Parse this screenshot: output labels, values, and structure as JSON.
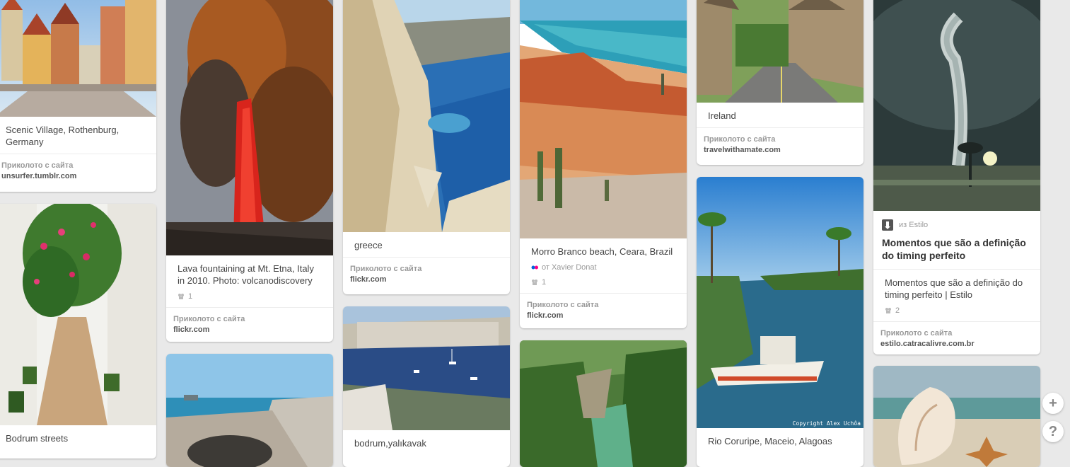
{
  "pins": {
    "rothenburg": {
      "description": "Scenic Village, Rothenburg, Germany",
      "attr_label": "Приколото с сайта",
      "attr_domain": "unsurfer.tumblr.com"
    },
    "bodrum_streets": {
      "description": "Bodrum streets"
    },
    "etna": {
      "description": "Lava fountaining at Mt. Etna, Italy in 2010. Photo: volcanodiscovery",
      "repin_count": "1",
      "attr_label": "Приколото с сайта",
      "attr_domain": "flickr.com"
    },
    "greece": {
      "description": "greece",
      "attr_label": "Приколото с сайта",
      "attr_domain": "flickr.com"
    },
    "yalikavak": {
      "description": "bodrum,yalıkavak"
    },
    "morro": {
      "description": "Morro Branco beach, Ceara, Brazil",
      "from_user": "от Xavier Donat",
      "repin_count": "1",
      "attr_label": "Приколото с сайта",
      "attr_domain": "flickr.com"
    },
    "ireland": {
      "description": "Ireland",
      "attr_label": "Приколото с сайта",
      "attr_domain": "travelwithamate.com"
    },
    "coruripe": {
      "description": "Rio Coruripe, Maceio, Alagoas",
      "watermark": "Copyright Alex Uchôa"
    },
    "estilo": {
      "source": "из Estilo",
      "rich_title": "Momentos que são a definição do timing perfeito",
      "description": "Momentos que são a definição do timing perfeito | Estilo",
      "repin_count": "2",
      "attr_label": "Приколото с сайта",
      "attr_domain": "estilo.catracalivre.com.br"
    }
  },
  "side_buttons": {
    "add": "+",
    "help": "?"
  }
}
